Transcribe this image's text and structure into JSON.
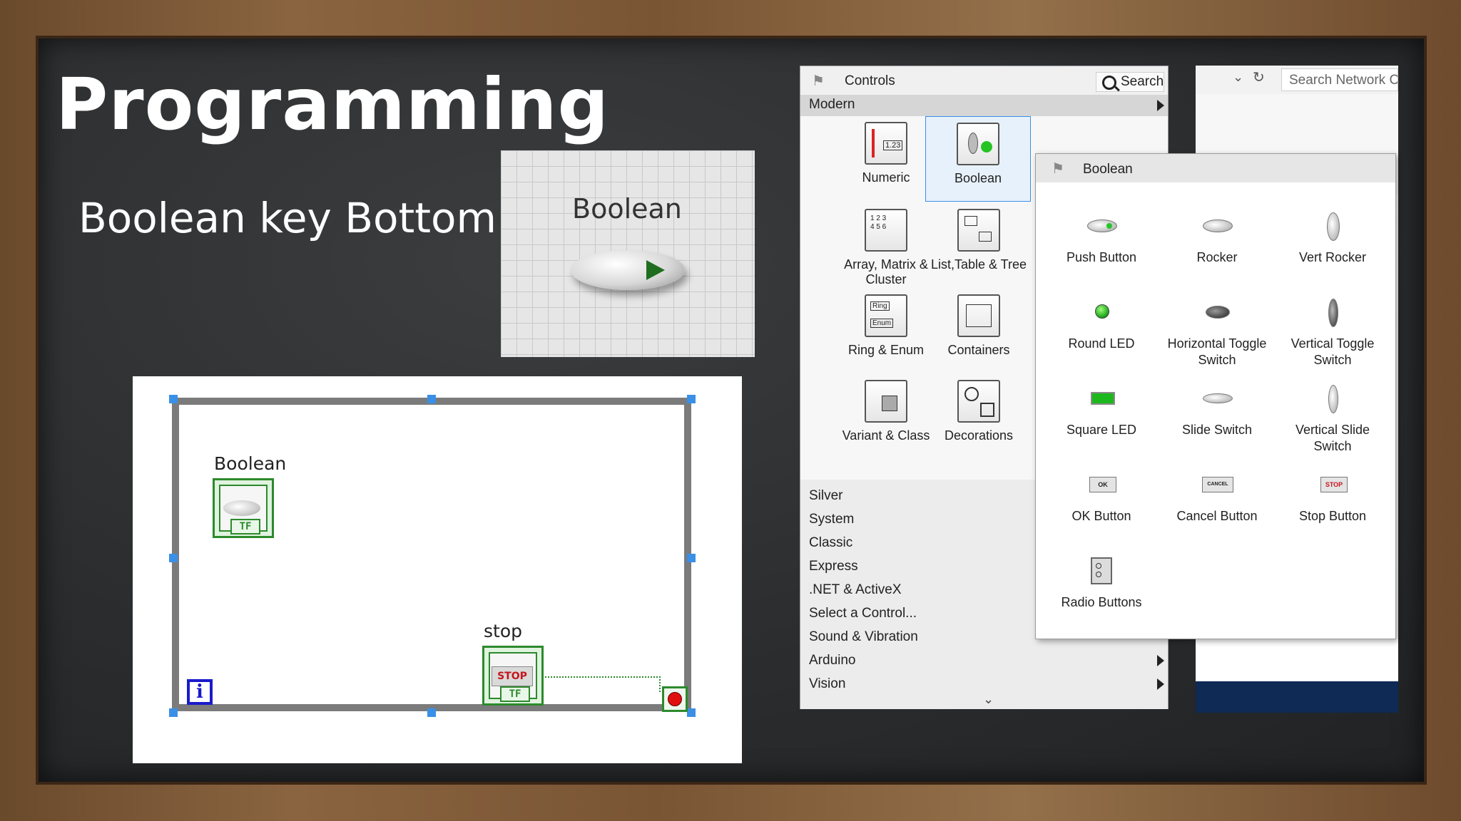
{
  "slide": {
    "title": "Programming",
    "subtitle": "Boolean key Bottom"
  },
  "front_panel": {
    "control_label": "Boolean"
  },
  "block_diagram": {
    "boolean_label": "Boolean",
    "boolean_terminal": "TF",
    "stop_label": "stop",
    "stop_button_text": "STOP",
    "stop_terminal": "TF",
    "iteration_terminal": "i"
  },
  "back_window": {
    "search_placeholder": "Search Network C"
  },
  "controls_palette": {
    "title": "Controls",
    "search_label": "Search",
    "current_category": "Modern",
    "items": [
      {
        "label": "Numeric",
        "icon": "numeric-icon"
      },
      {
        "label": "Boolean",
        "icon": "boolean-icon",
        "selected": true
      },
      {
        "label": "Array, Matrix & Cluster",
        "icon": "array-matrix-cluster-icon"
      },
      {
        "label": "List,Table & Tree",
        "icon": "list-table-tree-icon"
      },
      {
        "label": "Ring & Enum",
        "icon": "ring-enum-icon"
      },
      {
        "label": "Containers",
        "icon": "containers-icon"
      },
      {
        "label": "Variant & Class",
        "icon": "variant-class-icon"
      },
      {
        "label": "Decorations",
        "icon": "decorations-icon"
      }
    ],
    "categories": [
      "Silver",
      "System",
      "Classic",
      "Express",
      ".NET & ActiveX",
      "Select a Control...",
      "Sound & Vibration",
      "Arduino",
      "Vision"
    ]
  },
  "boolean_palette": {
    "title": "Boolean",
    "items": [
      {
        "label": "Push Button",
        "icon": "push-button-icon"
      },
      {
        "label": "Rocker",
        "icon": "rocker-icon"
      },
      {
        "label": "Vert Rocker",
        "icon": "vert-rocker-icon"
      },
      {
        "label": "Round LED",
        "icon": "round-led-icon"
      },
      {
        "label": "Horizontal Toggle Switch",
        "icon": "horizontal-toggle-switch-icon"
      },
      {
        "label": "Vertical Toggle Switch",
        "icon": "vertical-toggle-switch-icon"
      },
      {
        "label": "Square LED",
        "icon": "square-led-icon"
      },
      {
        "label": "Slide Switch",
        "icon": "slide-switch-icon"
      },
      {
        "label": "Vertical Slide Switch",
        "icon": "vertical-slide-switch-icon"
      },
      {
        "label": "OK Button",
        "icon": "ok-button-icon",
        "icon_text": "OK"
      },
      {
        "label": "Cancel Button",
        "icon": "cancel-button-icon",
        "icon_text": "CANCEL"
      },
      {
        "label": "Stop Button",
        "icon": "stop-button-icon",
        "icon_text": "STOP"
      },
      {
        "label": "Radio Buttons",
        "icon": "radio-buttons-icon"
      }
    ]
  }
}
